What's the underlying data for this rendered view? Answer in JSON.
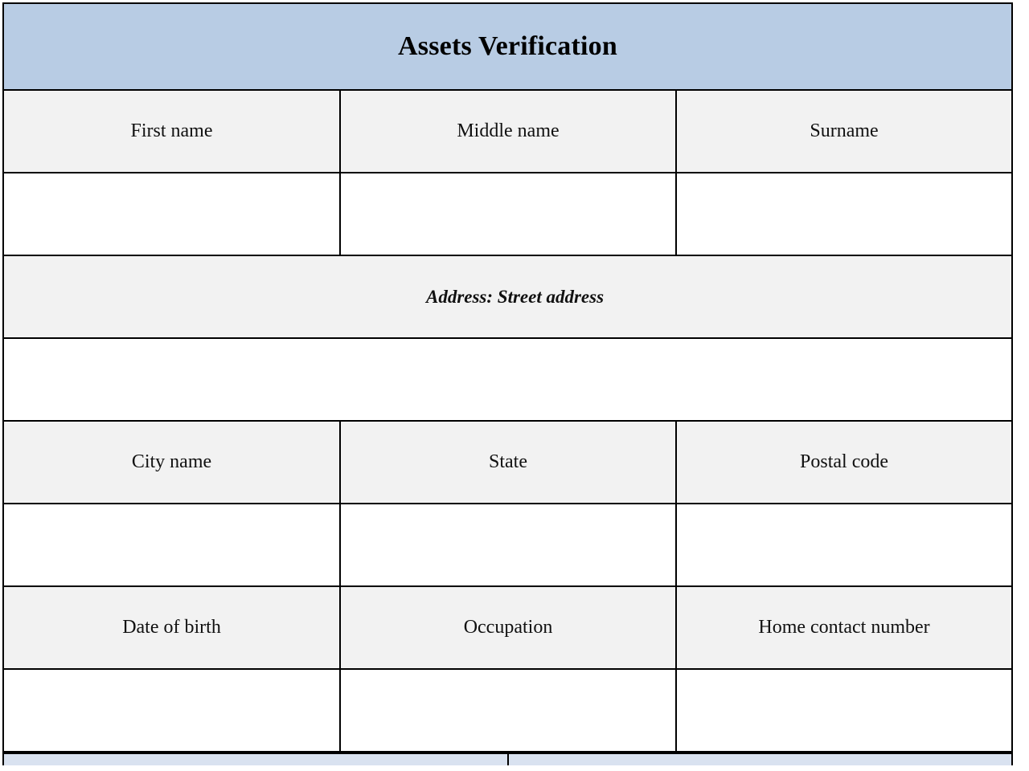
{
  "document": {
    "title": "Assets Verification",
    "accent_color": "#b8cce4",
    "label_row_color": "#f2f2f2",
    "input_row_color": "#ffffff",
    "border_color": "#000000",
    "footer_band_color": "#d9e2f0"
  },
  "sections": {
    "name_row": {
      "labels": [
        "First name",
        "Middle name",
        "Surname"
      ],
      "values": [
        "",
        "",
        ""
      ]
    },
    "address": {
      "label": "Address: Street address",
      "value": ""
    },
    "location_row": {
      "labels": [
        "City name",
        "State",
        "Postal code"
      ],
      "values": [
        "",
        "",
        ""
      ]
    },
    "personal_row": {
      "labels": [
        "Date of birth",
        "Occupation",
        "Home contact number"
      ],
      "values": [
        "",
        "",
        ""
      ]
    },
    "next_section": {
      "cells": [
        "",
        ""
      ]
    }
  }
}
